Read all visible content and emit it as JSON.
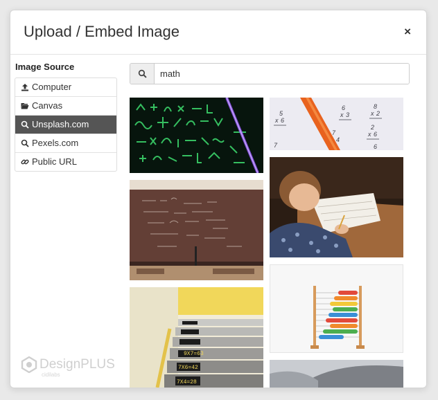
{
  "modal": {
    "title": "Upload / Embed Image",
    "close_glyph": "×"
  },
  "sidebar": {
    "title": "Image Source",
    "items": [
      {
        "label": "Computer",
        "icon": "upload-icon",
        "active": false
      },
      {
        "label": "Canvas",
        "icon": "folder-open-icon",
        "active": false
      },
      {
        "label": "Unsplash.com",
        "icon": "search-icon",
        "active": true
      },
      {
        "label": "Pexels.com",
        "icon": "search-icon",
        "active": false
      },
      {
        "label": "Public URL",
        "icon": "link-icon",
        "active": false
      }
    ]
  },
  "search": {
    "value": "math",
    "icon": "search-icon"
  },
  "results": [
    {
      "subject": "green math equations on black screen"
    },
    {
      "subject": "multiplication worksheet with orange pencil"
    },
    {
      "subject": "chalkboard with equations in classroom"
    },
    {
      "subject": "child writing in notebook at desk"
    },
    {
      "subject": "stairs with numbers on steps"
    },
    {
      "subject": "wooden abacus with colorful beads"
    },
    {
      "subject": "partially visible image"
    }
  ],
  "branding": {
    "name": "DesignPLUS",
    "sub": "cidilabs"
  },
  "colors": {
    "active_item_bg": "#555555",
    "title_text": "#333333"
  }
}
